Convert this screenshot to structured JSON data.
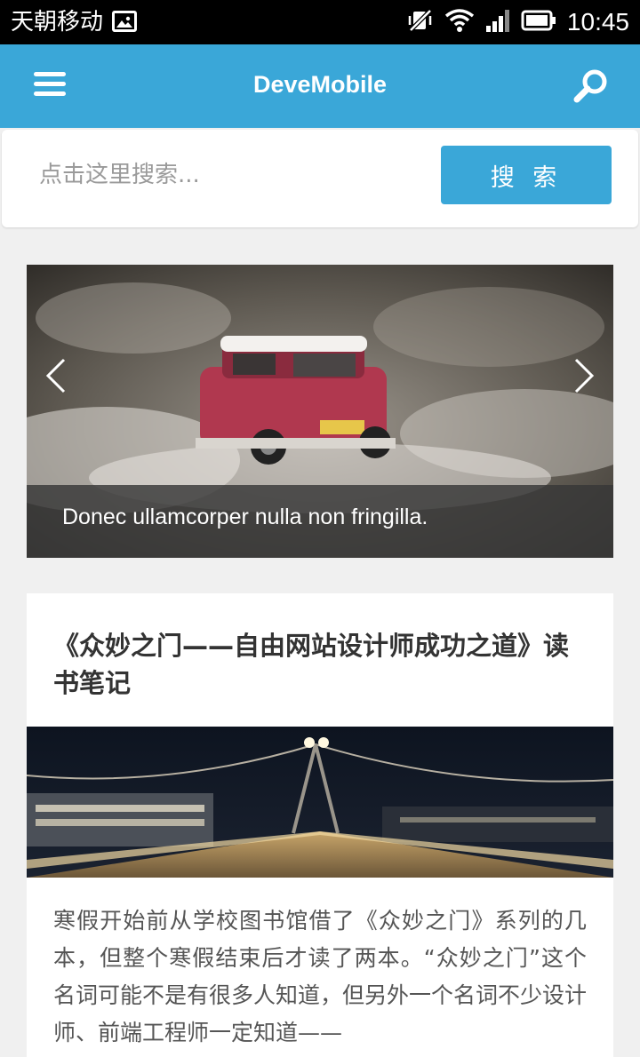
{
  "status_bar": {
    "carrier": "天朝移动",
    "time": "10:45",
    "icons": [
      "image-icon",
      "muted-vibrate-icon",
      "wifi-icon",
      "signal-icon",
      "battery-icon"
    ]
  },
  "app_bar": {
    "title": "DeveMobile",
    "background": "#3aa7d8",
    "left_icon": "hamburger-menu-icon",
    "right_icon": "search-icon"
  },
  "search": {
    "placeholder": "点击这里搜索...",
    "value": "",
    "button_label": "搜 索"
  },
  "carousel": {
    "caption": "Donec ullamcorper nulla non fringilla.",
    "prev_icon": "chevron-left-icon",
    "next_icon": "chevron-right-icon"
  },
  "article": {
    "title": "《众妙之门——自由网站设计师成功之道》读书笔记",
    "excerpt": "寒假开始前从学校图书馆借了《众妙之门》系列的几本，但整个寒假结束后才读了两本。“众妙之门”这个名词可能不是有很多人知道，但另外一个名词不少设计师、前端工程师一定知道——"
  },
  "colors": {
    "accent": "#3aa7d8",
    "page_background": "#f0f0f0"
  }
}
